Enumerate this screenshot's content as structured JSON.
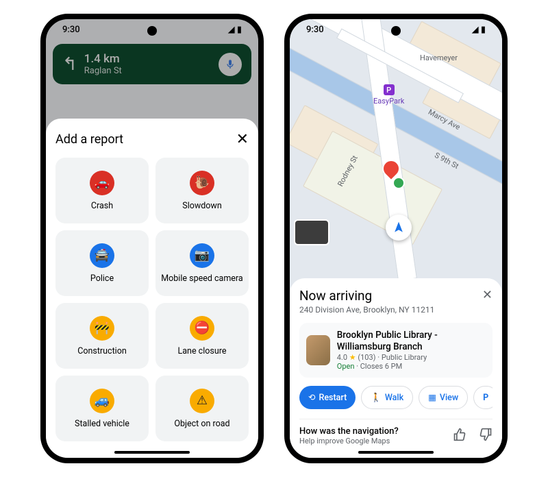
{
  "status": {
    "time": "9:30"
  },
  "phone1": {
    "nav": {
      "distance": "1.4 km",
      "street": "Raglan St"
    },
    "sheet": {
      "title": "Add a report",
      "items": [
        {
          "label": "Crash",
          "icon": "crash",
          "color": "red"
        },
        {
          "label": "Slowdown",
          "icon": "slowdown",
          "color": "red"
        },
        {
          "label": "Police",
          "icon": "police",
          "color": "blue"
        },
        {
          "label": "Mobile speed camera",
          "icon": "speed-camera",
          "color": "blue"
        },
        {
          "label": "Construction",
          "icon": "construction",
          "color": "yellow"
        },
        {
          "label": "Lane closure",
          "icon": "lane-closure",
          "color": "yellow"
        },
        {
          "label": "Stalled vehicle",
          "icon": "stalled",
          "color": "yellow"
        },
        {
          "label": "Object on road",
          "icon": "object",
          "color": "yellow"
        }
      ]
    }
  },
  "phone2": {
    "map_labels": {
      "havemeyer": "Havemeyer",
      "marcy": "Marcy Ave",
      "rodney": "Rodney St",
      "s9th": "S 9th St",
      "easypark": "EasyPark"
    },
    "arrival": {
      "title": "Now arriving",
      "address": "240 Division Ave, Brooklyn, NY 11211",
      "place": {
        "name": "Brooklyn Public Library - Williamsburg Branch",
        "rating": "4.0",
        "review_count": "(103)",
        "category": "Public Library",
        "status": "Open",
        "closes": "Closes 6 PM"
      },
      "actions": {
        "restart": "Restart",
        "walk": "Walk",
        "view": "View",
        "park": "P"
      },
      "feedback": {
        "question": "How was the navigation?",
        "subtitle": "Help improve Google Maps"
      }
    }
  }
}
